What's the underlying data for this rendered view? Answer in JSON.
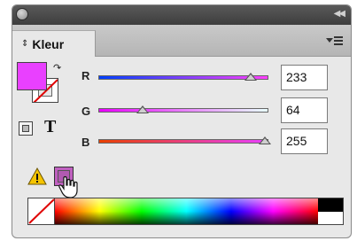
{
  "panel": {
    "tab_label": "Kleur",
    "tab_arrows": "⇕",
    "collapse_glyph": "◀◀"
  },
  "swatches": {
    "fill_color": "#e940ff",
    "swap_glyph": "↷",
    "text_icon": "T"
  },
  "sliders": [
    {
      "label": "R",
      "value": "233",
      "fraction": 0.914
    },
    {
      "label": "G",
      "value": "64",
      "fraction": 0.251
    },
    {
      "label": "B",
      "value": "255",
      "fraction": 1.0
    }
  ],
  "colors": {
    "r_track": "linear-gradient(to right, #0040ff, #ff40ff)",
    "g_track": "linear-gradient(to right, #e900ff, #e9ffff)",
    "b_track": "linear-gradient(to right, #e94000, #e940ff)",
    "websafe": "#cc66cc",
    "warning": "#f5c400"
  }
}
